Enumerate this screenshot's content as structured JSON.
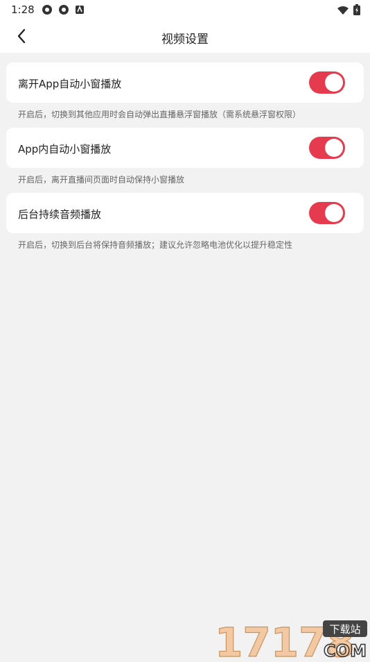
{
  "status_bar": {
    "time": "1:28"
  },
  "header": {
    "title": "视频设置"
  },
  "settings": [
    {
      "label": "离开App自动小窗播放",
      "enabled": true,
      "description": "开启后，切换到其他应用时会自动弹出直播悬浮窗播放（需系统悬浮窗权限）"
    },
    {
      "label": "App内自动小窗播放",
      "enabled": true,
      "description": "开启后，离开直播间页面时自动保持小窗播放"
    },
    {
      "label": "后台持续音频播放",
      "enabled": true,
      "description": "开启后，切换到后台将保持音频播放；建议允许忽略电池优化以提升稳定性"
    }
  ],
  "colors": {
    "toggle_on": "#e63a4e",
    "background": "#f2f2f2"
  },
  "watermark": {
    "numbers": "17178",
    "tag": "下载站",
    "domain": "COM"
  }
}
